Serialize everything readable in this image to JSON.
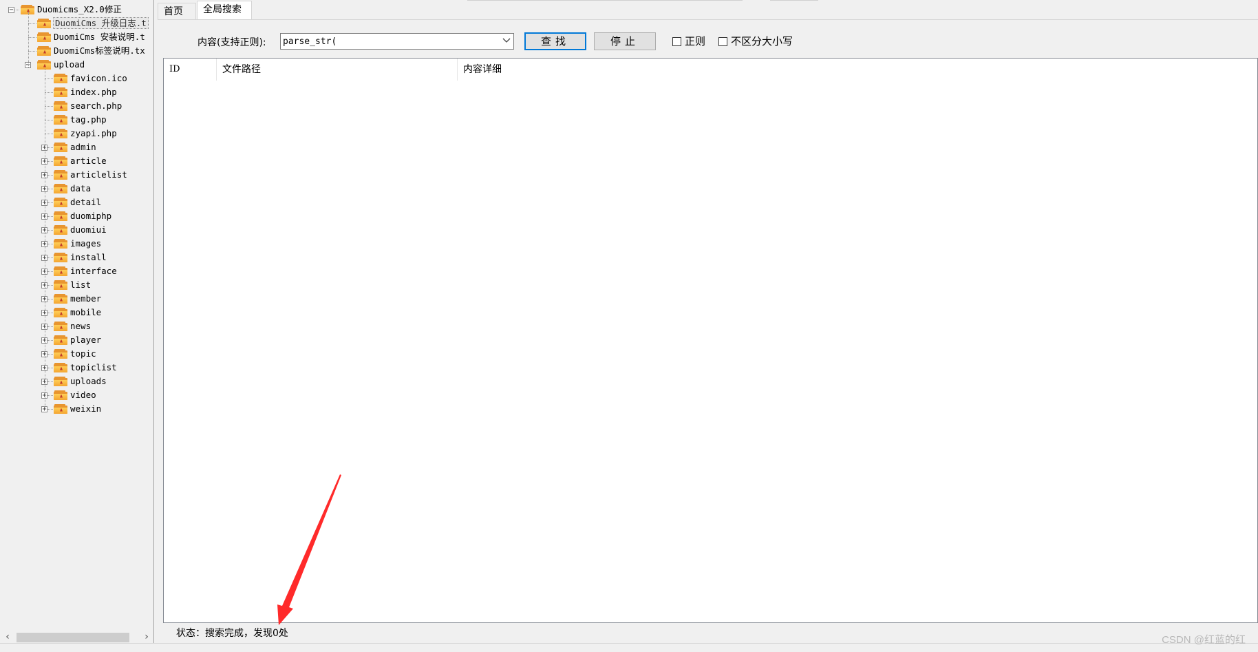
{
  "tree": {
    "root": {
      "label": "Duomicms_X2.0修正",
      "expanded": true
    },
    "root_files": [
      {
        "label": "DuomiCms 升级日志.t",
        "selected": true
      },
      {
        "label": "DuomiCms 安装说明.t"
      },
      {
        "label": "DuomiCms标签说明.tx"
      }
    ],
    "upload": {
      "label": "upload",
      "expanded": true
    },
    "upload_files": [
      "favicon.ico",
      "index.php",
      "search.php",
      "tag.php",
      "zyapi.php"
    ],
    "upload_folders": [
      "admin",
      "article",
      "articlelist",
      "data",
      "detail",
      "duomiphp",
      "duomiui",
      "images",
      "install",
      "interface",
      "list",
      "member",
      "mobile",
      "news",
      "player",
      "topic",
      "topiclist",
      "uploads",
      "video",
      "weixin"
    ]
  },
  "tabs": {
    "home": "首页",
    "search": "全局搜索"
  },
  "search": {
    "label": "内容(支持正则):",
    "value": "parse_str(",
    "find_button": "查找",
    "stop_button": "停止",
    "regex_label": "正则",
    "nocase_label": "不区分大小写"
  },
  "results": {
    "columns": [
      "ID",
      "文件路径",
      "内容详细"
    ],
    "rows": []
  },
  "status": {
    "text": "状态：搜索完成，发现0处"
  },
  "watermark": "CSDN @红蓝的红",
  "colors": {
    "accent": "#0078d7",
    "annotation": "#ff2a2a",
    "folder": "#f4a532"
  }
}
